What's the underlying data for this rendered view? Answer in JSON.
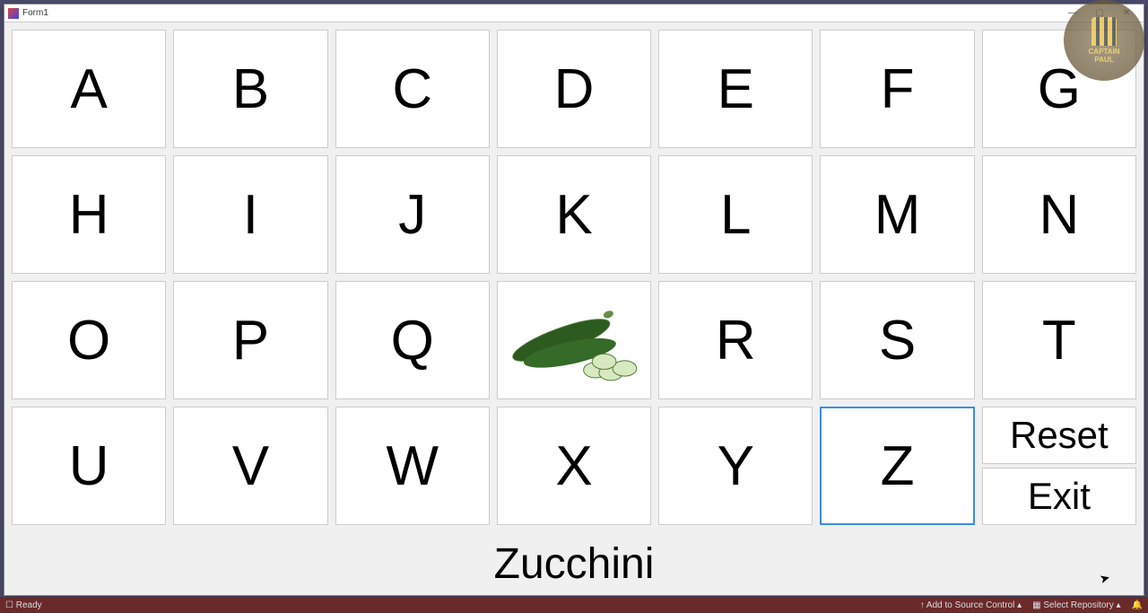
{
  "window": {
    "title": "Form1"
  },
  "grid": {
    "cells": [
      {
        "label": "A"
      },
      {
        "label": "B"
      },
      {
        "label": "C"
      },
      {
        "label": "D"
      },
      {
        "label": "E"
      },
      {
        "label": "F"
      },
      {
        "label": "G"
      },
      {
        "label": "H"
      },
      {
        "label": "I"
      },
      {
        "label": "J"
      },
      {
        "label": "K"
      },
      {
        "label": "L"
      },
      {
        "label": "M"
      },
      {
        "label": "N"
      },
      {
        "label": "O"
      },
      {
        "label": "P"
      },
      {
        "label": "Q"
      },
      {
        "image": "zucchini"
      },
      {
        "label": "R"
      },
      {
        "label": "S"
      },
      {
        "label": "T"
      },
      {
        "label": "U"
      },
      {
        "label": "V"
      },
      {
        "label": "W"
      },
      {
        "label": "X"
      },
      {
        "label": "Y"
      },
      {
        "label": "Z",
        "selected": true
      }
    ]
  },
  "actions": {
    "reset": "Reset",
    "exit": "Exit"
  },
  "display": "Zucchini",
  "logo": {
    "line1": "CAPTAIN",
    "line2": "PAUL"
  },
  "statusbar": {
    "ready": "Ready",
    "source": "Add to Source Control",
    "repo": "Select Repository"
  }
}
